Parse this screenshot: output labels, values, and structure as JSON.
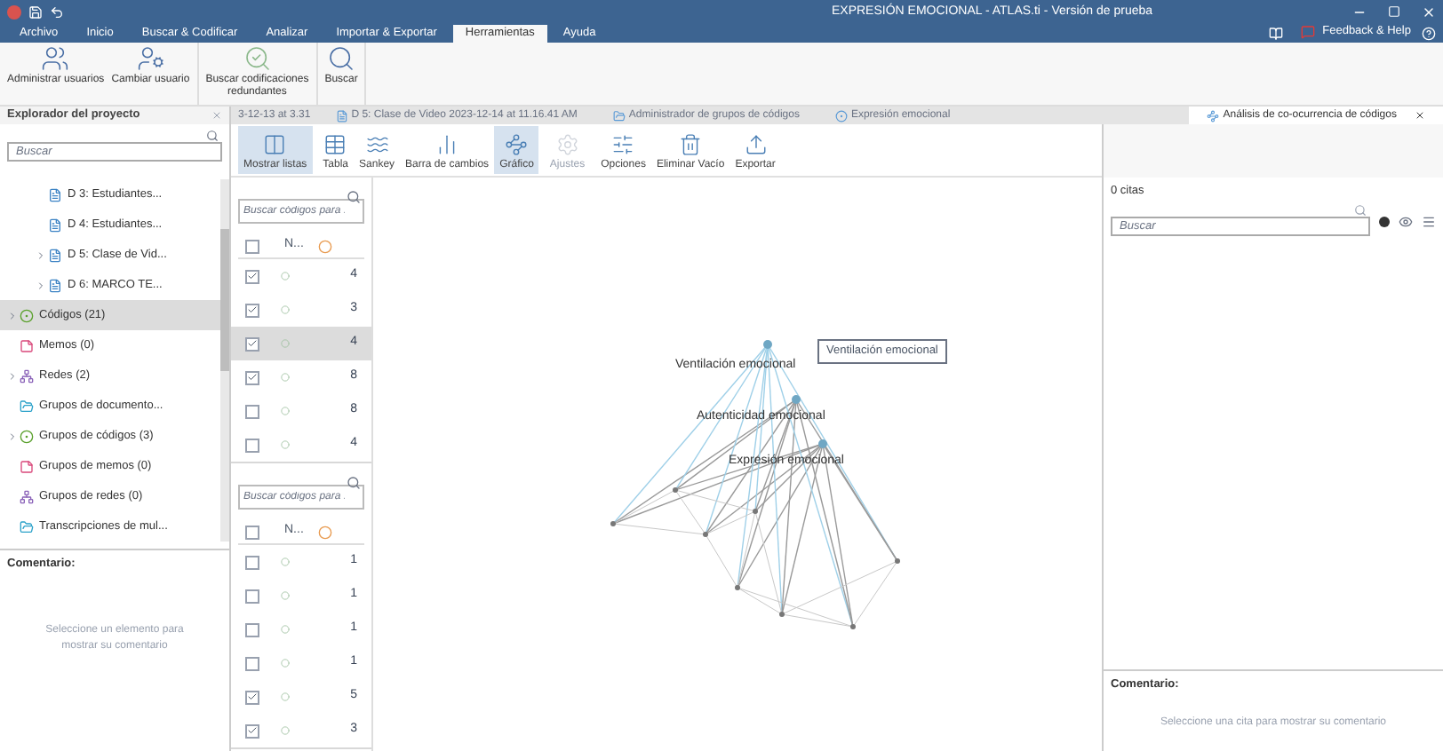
{
  "window": {
    "title": "EXPRESIÓN EMOCIONAL - ATLAS.ti - Versión de prueba"
  },
  "help": {
    "label": "Feedback & Help"
  },
  "menu": [
    {
      "label": "Archivo",
      "selected": false
    },
    {
      "label": "Inicio",
      "selected": false
    },
    {
      "label": "Buscar & Codificar",
      "selected": false
    },
    {
      "label": "Analizar",
      "selected": false
    },
    {
      "label": "Importar & Exportar",
      "selected": false
    },
    {
      "label": "Herramientas",
      "selected": true
    },
    {
      "label": "Ayuda",
      "selected": false
    }
  ],
  "ribbon": [
    {
      "label": "Administrar usuarios",
      "kind": "users"
    },
    {
      "label": "Cambiar usuario",
      "kind": "user"
    },
    {
      "label": "Buscar codificaciones redundantes",
      "kind": "redundant"
    },
    {
      "label": "Buscar",
      "kind": "search"
    }
  ],
  "explorer": {
    "title": "Explorador del proyecto",
    "search": {
      "placeholder": "Buscar"
    },
    "items": [
      {
        "label": "D 3: Estudiantes...",
        "kind": "document",
        "expandable": false,
        "selected": false
      },
      {
        "label": "D 4: Estudiantes...",
        "kind": "document",
        "expandable": false,
        "selected": false
      },
      {
        "label": "D 5: Clase de Vid...",
        "kind": "document",
        "expandable": true,
        "selected": false
      },
      {
        "label": "D 6: MARCO TE...",
        "kind": "document",
        "expandable": true,
        "selected": false
      },
      {
        "label": "Códigos (21)",
        "kind": "codes",
        "expandable": true,
        "selected": true
      },
      {
        "label": "Memos (0)",
        "kind": "memos",
        "expandable": false,
        "selected": false
      },
      {
        "label": "Redes (2)",
        "kind": "networks",
        "expandable": true,
        "selected": false
      },
      {
        "label": "Grupos de documento...",
        "kind": "docgroups",
        "expandable": false,
        "selected": false
      },
      {
        "label": "Grupos de códigos (3)",
        "kind": "codes",
        "expandable": true,
        "selected": false
      },
      {
        "label": "Grupos de memos (0)",
        "kind": "memos",
        "expandable": false,
        "selected": false
      },
      {
        "label": "Grupos de redes (0)",
        "kind": "networks",
        "expandable": false,
        "selected": false
      },
      {
        "label": "Transcripciones de mul...",
        "kind": "docgroups",
        "expandable": false,
        "selected": false
      }
    ],
    "comment": {
      "title": "Comentario:",
      "hint": "Seleccione un elemento para mostrar su comentario"
    }
  },
  "doc_tabs": [
    {
      "label": "3-12-13 at 3.31",
      "kind": "plain",
      "selected": false
    },
    {
      "label": "D 5: Clase de Video 2023-12-14 at 11.16.41 AM",
      "kind": "document",
      "selected": false
    },
    {
      "label": "Administrador de grupos de códigos",
      "kind": "groups",
      "selected": false
    },
    {
      "label": "Expresión emocional",
      "kind": "code",
      "selected": false
    },
    {
      "label": "Análisis de co-ocurrencia de códigos",
      "kind": "cooccurrence",
      "selected": true
    }
  ],
  "toolbar": [
    {
      "label": "Mostrar listas",
      "kind": "lists",
      "selected": true,
      "disabled": false
    },
    {
      "label": "Tabla",
      "kind": "table",
      "selected": false,
      "disabled": false
    },
    {
      "label": "Sankey",
      "kind": "sankey",
      "selected": false,
      "disabled": false
    },
    {
      "label": "Barra de cambios",
      "kind": "bars",
      "selected": false,
      "disabled": false
    },
    {
      "label": "Gráfico",
      "kind": "graph",
      "selected": true,
      "disabled": false
    },
    {
      "label": "Ajustes",
      "kind": "settings",
      "selected": false,
      "disabled": true
    },
    {
      "label": "Opciones",
      "kind": "options",
      "selected": false,
      "disabled": false
    },
    {
      "label": "Eliminar Vacío",
      "kind": "remove",
      "selected": false,
      "disabled": false
    },
    {
      "label": "Exportar",
      "kind": "export",
      "selected": false,
      "disabled": false
    }
  ],
  "code_lists": [
    {
      "search": {
        "placeholder": "Buscar códigos para ."
      },
      "column": "N...",
      "all_checked": false,
      "rows": [
        {
          "checked": true,
          "count": "4",
          "selected": false
        },
        {
          "checked": true,
          "count": "3",
          "selected": false
        },
        {
          "checked": true,
          "count": "4",
          "selected": true
        },
        {
          "checked": true,
          "count": "8",
          "selected": false
        },
        {
          "checked": false,
          "count": "8",
          "selected": false
        },
        {
          "checked": false,
          "count": "4",
          "selected": false
        }
      ]
    },
    {
      "search": {
        "placeholder": "Buscar códigos para ."
      },
      "column": "N...",
      "all_checked": false,
      "rows": [
        {
          "checked": false,
          "count": "1",
          "selected": false
        },
        {
          "checked": false,
          "count": "1",
          "selected": false
        },
        {
          "checked": false,
          "count": "1",
          "selected": false
        },
        {
          "checked": false,
          "count": "1",
          "selected": false
        },
        {
          "checked": true,
          "count": "5",
          "selected": false
        },
        {
          "checked": true,
          "count": "3",
          "selected": false
        }
      ]
    }
  ],
  "graph": {
    "nodes": [
      "Ventilación emocional",
      "Autenticidad emocional",
      "Expresión emocional"
    ],
    "tooltip": "Ventilación emocional"
  },
  "quotes": {
    "title": "0 citas",
    "search": {
      "placeholder": "Buscar"
    },
    "comment": {
      "title": "Comentario:",
      "hint": "Seleccione una cita para mostrar su comentario"
    }
  }
}
